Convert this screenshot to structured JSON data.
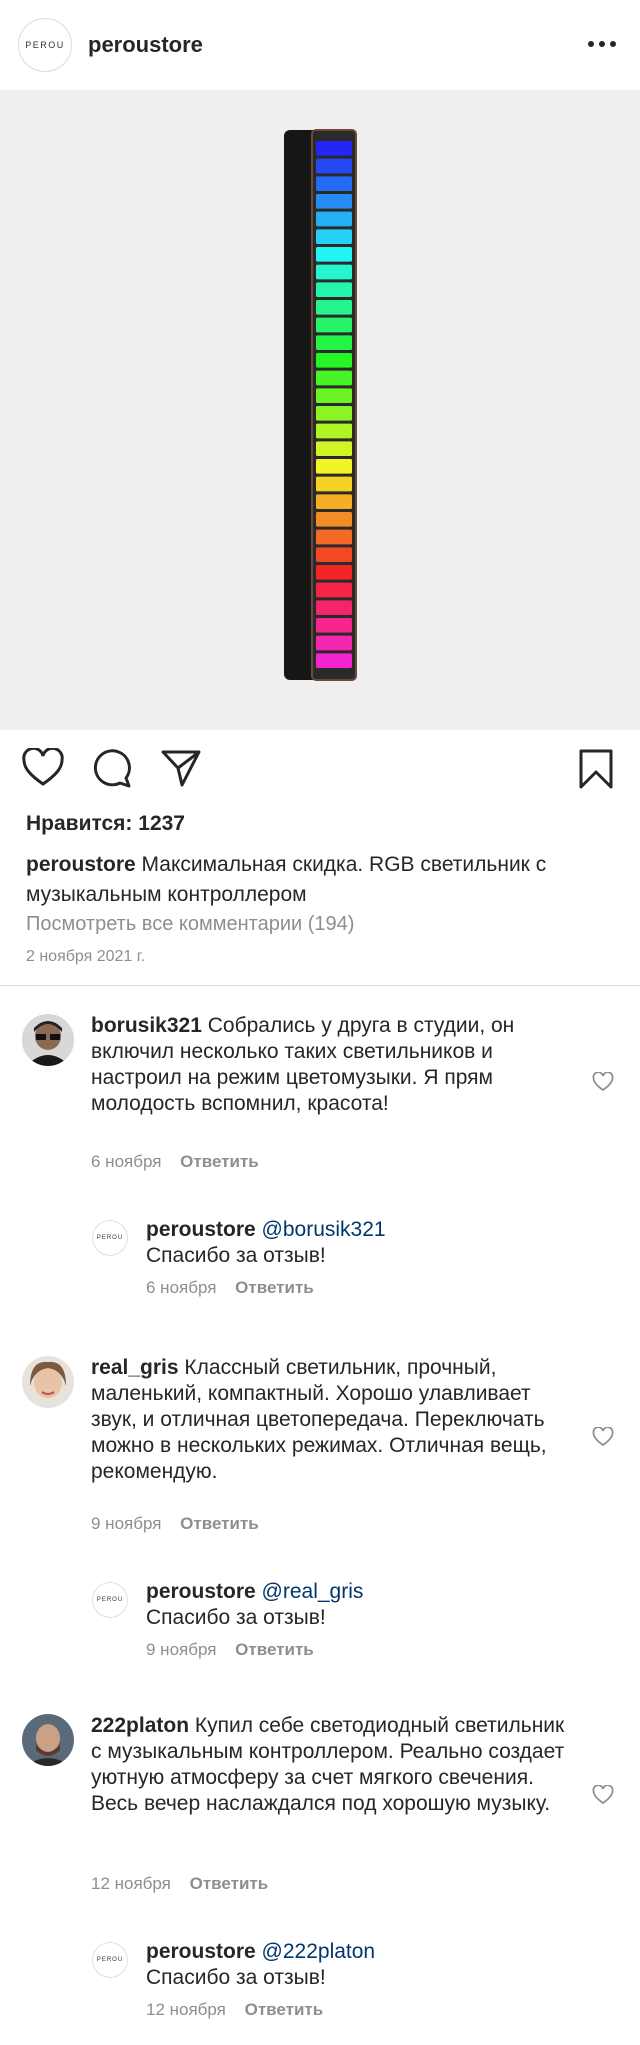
{
  "header": {
    "logo_text": "PEROU",
    "username": "peroustore",
    "more_icon": "more-horizontal-icon"
  },
  "post": {
    "likes_text": "Нравится: 1237",
    "caption_user": "peroustore",
    "caption_text": "Максимальная скидка. RGB светильник с музыкальным контроллером",
    "view_all": "Посмотреть все комментарии (194)",
    "date": "2 ноября 2021 г."
  },
  "comments": [
    {
      "user": "borusik321",
      "text": "Собрались у друга в студии, он включил несколько таких светильников и настроил на режим цветомузыки. Я прям молодость вспомнил, красота!",
      "date": "6 ноября",
      "reply": "Ответить",
      "answer": {
        "user": "peroustore",
        "mention": "@borusik321",
        "text": "Спасибо за отзыв!",
        "date": "6 ноября",
        "reply": "Ответить"
      }
    },
    {
      "user": "real_gris",
      "text": "Классный светильник, прочный, маленький, компактный. Хорошо улавливает звук, и отличная цветопередача. Переключать можно в нескольких режимах. Отличная вещь, рекомендую.",
      "date": "9 ноября",
      "reply": "Ответить",
      "answer": {
        "user": "peroustore",
        "mention": "@real_gris",
        "text": "Спасибо за отзыв!",
        "date": "9 ноября",
        "reply": "Ответить"
      }
    },
    {
      "user": "222platon",
      "text": "Купил себе светодиодный светильник с музыкальным контроллером. Реально создает уютную атмосферу за счет мягкого свечения. Весь вечер наслаждался под хорошую музыку.",
      "date": "12 ноября",
      "reply": "Ответить",
      "answer": {
        "user": "peroustore",
        "mention": "@222platon",
        "text": "Спасибо за отзыв!",
        "date": "12 ноября",
        "reply": "Ответить"
      }
    }
  ],
  "colors": {
    "text": "#262626",
    "secondary": "#8e8e8e",
    "mention": "#00376b",
    "photo_bg": "#efefef"
  }
}
